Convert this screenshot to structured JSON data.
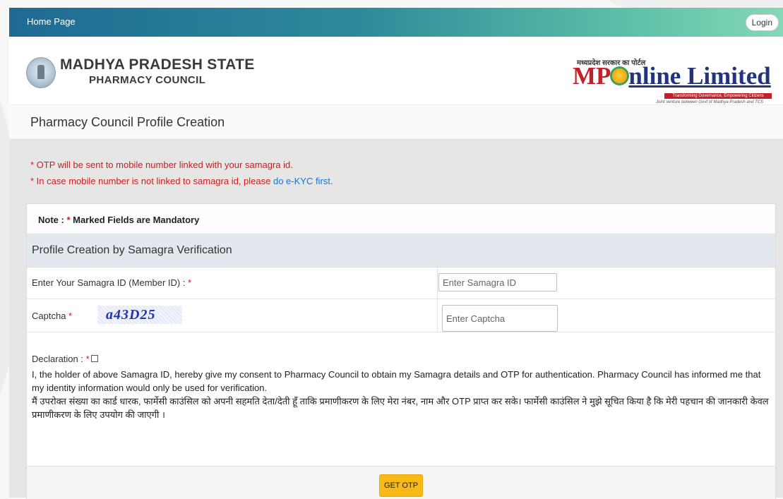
{
  "nav": {
    "home_label": "Home Page",
    "login_label": "Login"
  },
  "header": {
    "council_line1": "MADHYA PRADESH STATE",
    "council_line2": "PHARMACY COUNCIL",
    "mponline_tagline": "मध्यप्रदेश सरकार का पोर्टल",
    "mponline_name_prefix": "MP",
    "mponline_name_suffix": "nline Limited",
    "mponline_band": "Transforming Governance, Empowering Citizens",
    "mponline_subtext": "Joint venture between Govt of Madhya Pradesh and TCS"
  },
  "page": {
    "title": "Pharmacy Council Profile Creation"
  },
  "notices": {
    "line1": "* OTP will be sent to mobile number linked with your samagra id.",
    "line2_prefix": "* In case mobile number is not linked to samagra id, please ",
    "line2_link": "do e-KYC first",
    "line2_suffix": "."
  },
  "form": {
    "note_prefix": "Note : ",
    "note_star": "*",
    "note_text": " Marked Fields are Mandatory",
    "section_title": "Profile Creation by Samagra Verification",
    "samagra_label": "Enter Your Samagra ID (Member ID) : ",
    "samagra_placeholder": "Enter Samagra ID",
    "captcha_label": "Captcha ",
    "captcha_text": "a43D25",
    "captcha_placeholder": "Enter Captcha",
    "required_mark": "*",
    "declaration_label": "Declaration : ",
    "declaration_en": "I, the holder of above Samagra ID, hereby give my consent to Pharmacy Council to obtain my Samagra details and OTP for authentication. Pharmacy Council has informed me that my identity information would only be used for verification.",
    "declaration_hi": "मैं उपरोक्त संख्या का कार्ड धारक, फार्मेसी काउंसिल को अपनी सहमति देता/देती हूँ ताकि प्रमाणीकरण के लिए मेरा नंबर, नाम और OTP प्राप्त कर सके। फार्मेसी काउंसिल ने मुझे सूचित किया है कि मेरी पहचान की जानकारी केवल प्रमाणीकरण के लिए उपयोग की जाएगी ।",
    "submit_label": "GET OTP"
  },
  "colors": {
    "required": "#d51a1a",
    "link": "#1a73c9",
    "button": "#f7b916"
  }
}
